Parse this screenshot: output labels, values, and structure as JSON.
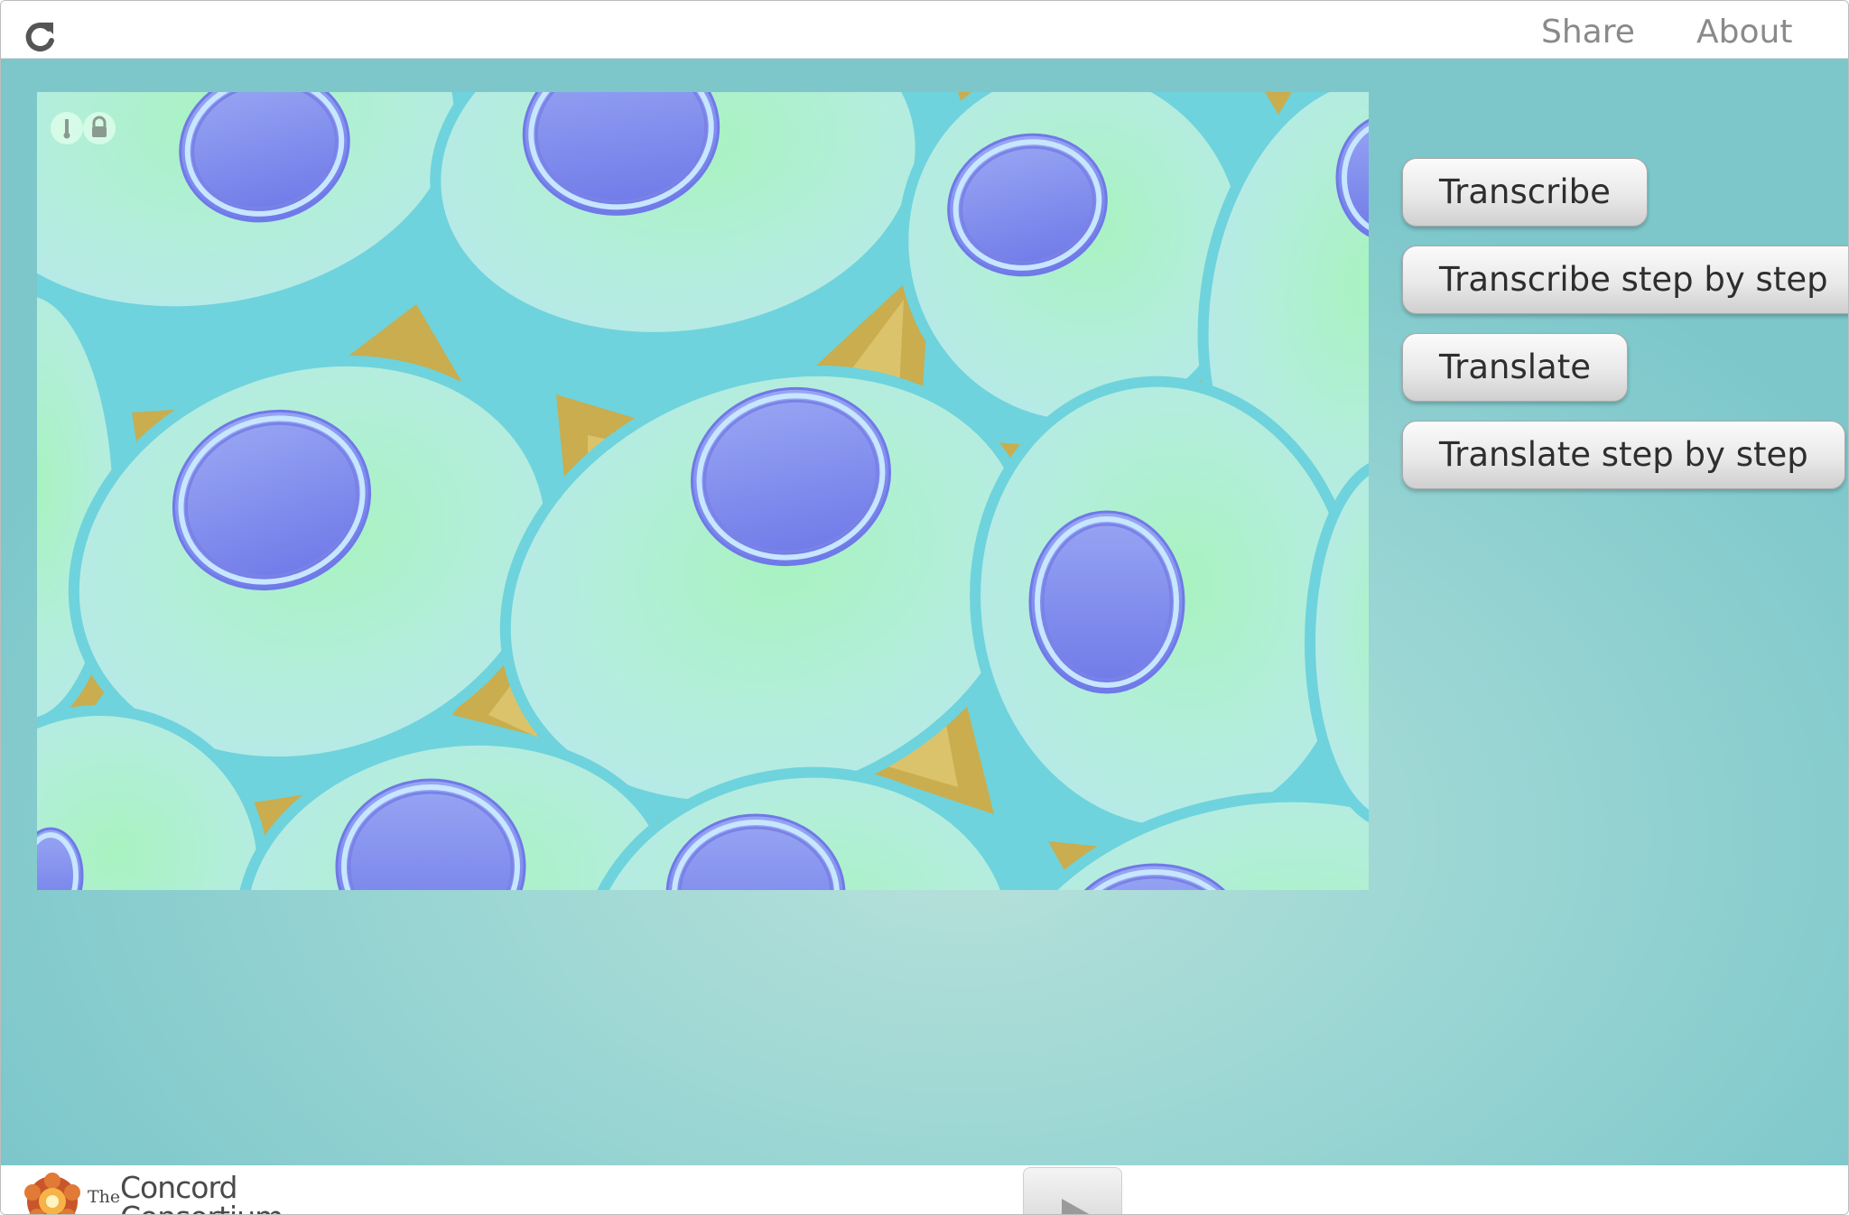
{
  "header": {
    "reload_icon": "refresh-icon",
    "share_label": "Share",
    "about_label": "About"
  },
  "simulation": {
    "view": "cell-tissue",
    "overlay_icons": [
      "thermometer-icon",
      "lock-icon"
    ]
  },
  "controls": {
    "transcribe_label": "Transcribe",
    "transcribe_step_label": "Transcribe step by step",
    "translate_label": "Translate",
    "translate_step_label": "Translate step by step"
  },
  "footer": {
    "logo_the": "The",
    "logo_name": "Concord Consortium",
    "play_icon": "play-icon"
  },
  "colors": {
    "stage_background": "#8ccfcf",
    "membrane": "#6ed3dc",
    "cytoplasm": "#b8eaeb",
    "cytoplasm_center": "#a8f3c0",
    "nucleus": "#7b86ec",
    "extracellular": "#d9bd5c",
    "button_text": "#2e2e2e",
    "nav_text": "#8a8a8a"
  }
}
